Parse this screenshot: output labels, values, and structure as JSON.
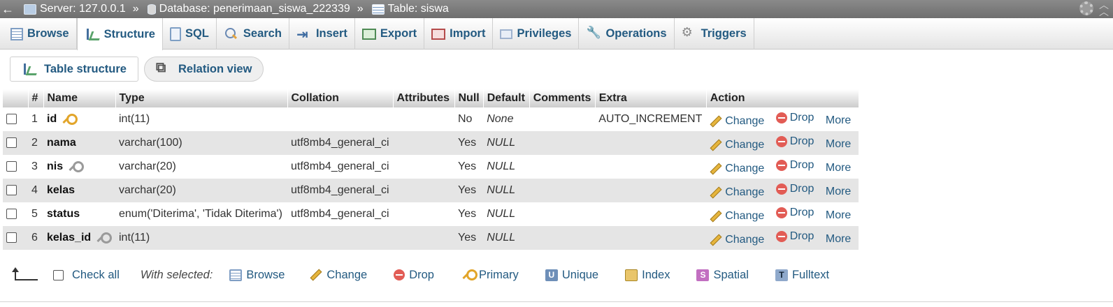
{
  "breadcrumb": {
    "back": "←",
    "server": "Server: 127.0.0.1",
    "database": "Database: penerimaan_siswa_222339",
    "table": "Table: siswa",
    "separator": "»"
  },
  "tabs": [
    {
      "label": "Browse",
      "icon": "browse-icon",
      "active": false
    },
    {
      "label": "Structure",
      "icon": "structure-icon",
      "active": true
    },
    {
      "label": "SQL",
      "icon": "sql-icon",
      "active": false
    },
    {
      "label": "Search",
      "icon": "search-icon",
      "active": false
    },
    {
      "label": "Insert",
      "icon": "insert-icon",
      "active": false
    },
    {
      "label": "Export",
      "icon": "export-icon",
      "active": false
    },
    {
      "label": "Import",
      "icon": "import-icon",
      "active": false
    },
    {
      "label": "Privileges",
      "icon": "privileges-icon",
      "active": false
    },
    {
      "label": "Operations",
      "icon": "wrench-icon",
      "active": false
    },
    {
      "label": "Triggers",
      "icon": "triggers-icon",
      "active": false
    }
  ],
  "subtabs": {
    "table_structure": "Table structure",
    "relation_view": "Relation view"
  },
  "table": {
    "headers": [
      "#",
      "Name",
      "Type",
      "Collation",
      "Attributes",
      "Null",
      "Default",
      "Comments",
      "Extra",
      "Action"
    ],
    "rows": [
      {
        "num": "1",
        "name": "id",
        "key": "primary",
        "type": "int(11)",
        "collation": "",
        "attributes": "",
        "null": "No",
        "default": "None",
        "comments": "",
        "extra": "AUTO_INCREMENT"
      },
      {
        "num": "2",
        "name": "nama",
        "key": "",
        "type": "varchar(100)",
        "collation": "utf8mb4_general_ci",
        "attributes": "",
        "null": "Yes",
        "default": "NULL",
        "comments": "",
        "extra": ""
      },
      {
        "num": "3",
        "name": "nis",
        "key": "index",
        "type": "varchar(20)",
        "collation": "utf8mb4_general_ci",
        "attributes": "",
        "null": "Yes",
        "default": "NULL",
        "comments": "",
        "extra": ""
      },
      {
        "num": "4",
        "name": "kelas",
        "key": "",
        "type": "varchar(20)",
        "collation": "utf8mb4_general_ci",
        "attributes": "",
        "null": "Yes",
        "default": "NULL",
        "comments": "",
        "extra": ""
      },
      {
        "num": "5",
        "name": "status",
        "key": "",
        "type": "enum('Diterima', 'Tidak Diterima')",
        "collation": "utf8mb4_general_ci",
        "attributes": "",
        "null": "Yes",
        "default": "NULL",
        "comments": "",
        "extra": ""
      },
      {
        "num": "6",
        "name": "kelas_id",
        "key": "index",
        "type": "int(11)",
        "collation": "",
        "attributes": "",
        "null": "Yes",
        "default": "NULL",
        "comments": "",
        "extra": ""
      }
    ],
    "actions": {
      "change": "Change",
      "drop": "Drop",
      "more": "More"
    }
  },
  "bottom": {
    "check_all": "Check all",
    "with_selected": "With selected:",
    "browse": "Browse",
    "change": "Change",
    "drop": "Drop",
    "primary": "Primary",
    "unique": "Unique",
    "index": "Index",
    "spatial": "Spatial",
    "fulltext": "Fulltext"
  },
  "colors": {
    "link": "#235a81",
    "topbar": "#7d7d7d",
    "row_alt": "#e5e5e5"
  }
}
